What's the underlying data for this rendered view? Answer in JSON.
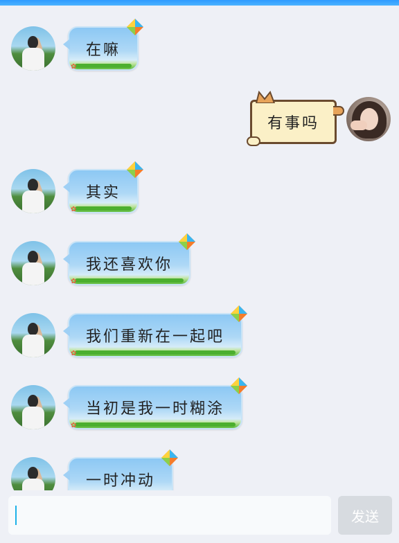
{
  "messages": [
    {
      "side": "left",
      "text": "在嘛"
    },
    {
      "side": "right",
      "text": "有事吗"
    },
    {
      "side": "left",
      "text": "其实"
    },
    {
      "side": "left",
      "text": "我还喜欢你"
    },
    {
      "side": "left",
      "text": "我们重新在一起吧"
    },
    {
      "side": "left",
      "text": "当初是我一时糊涂"
    },
    {
      "side": "left",
      "text": "一时冲动"
    }
  ],
  "composer": {
    "value": "",
    "send_label": "发送"
  },
  "colors": {
    "top_bar": "#2e9bff",
    "chat_background": "#eef0f6",
    "kite_bubble": "#9fd0f5",
    "cat_bubble": "#fbf0c7",
    "cursor": "#1db1e8",
    "send_button": "#d7dbe0"
  },
  "icons": [
    "kite-icon",
    "cat-ears-icon"
  ]
}
